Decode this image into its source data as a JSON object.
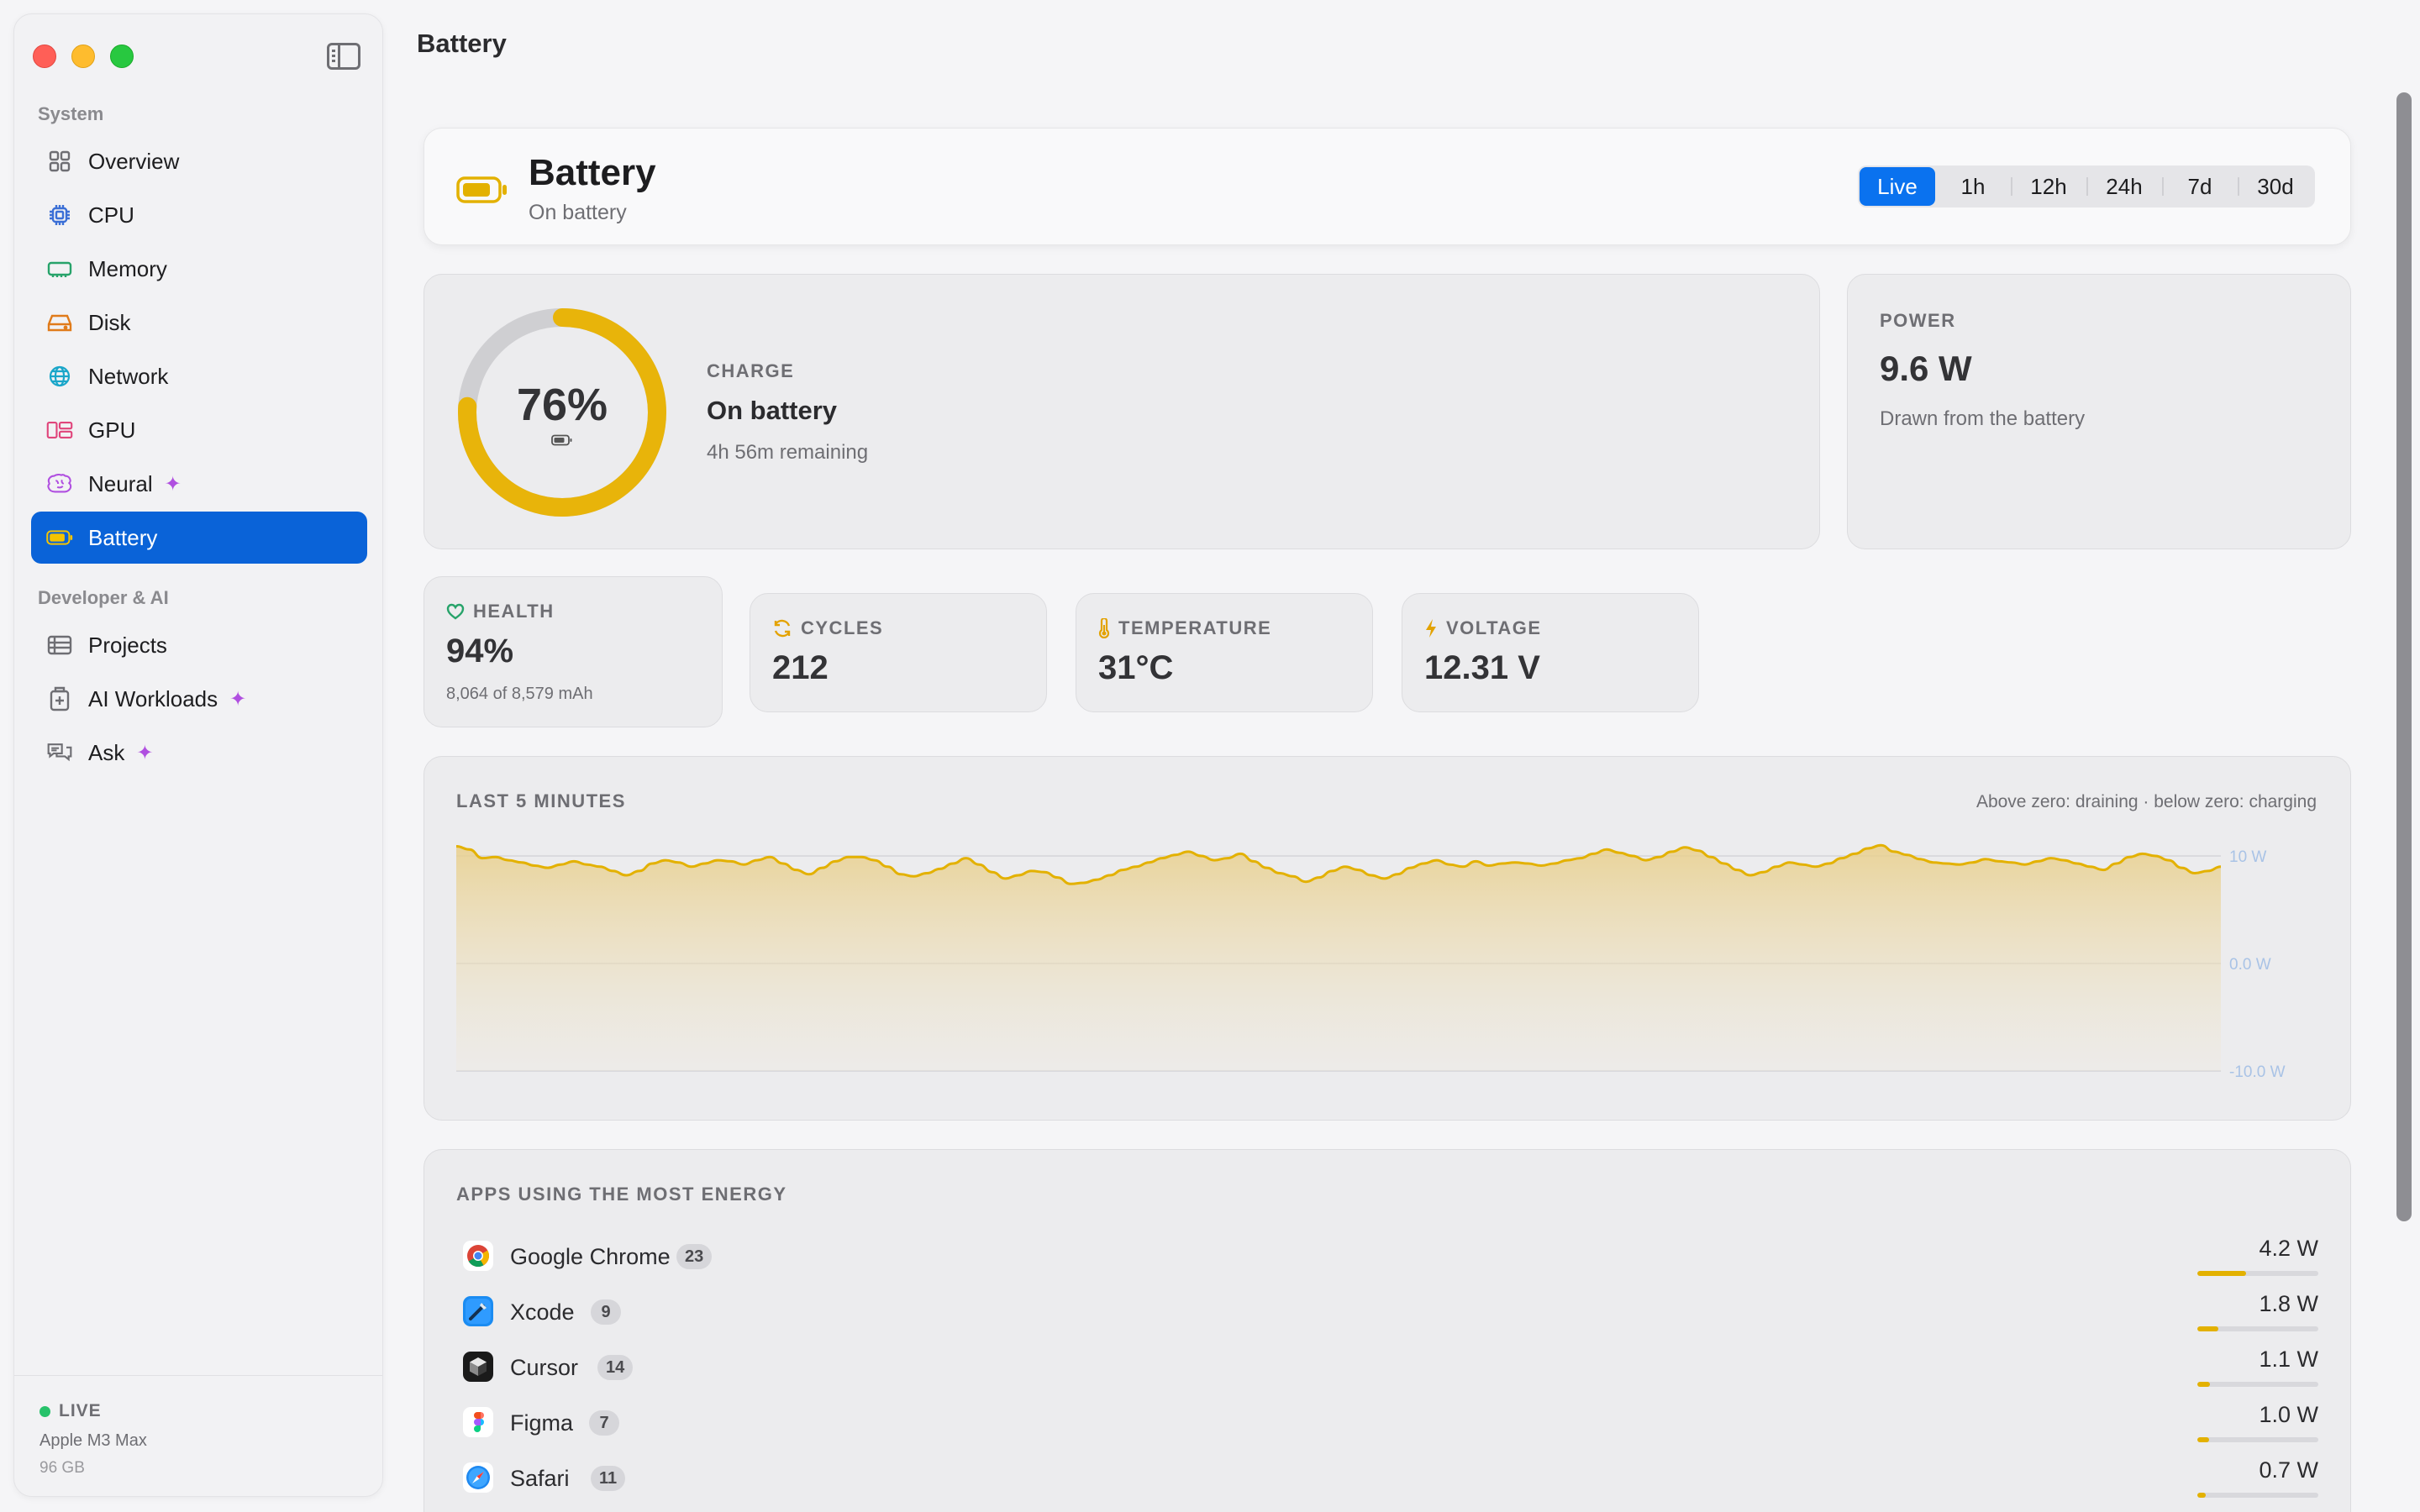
{
  "sidebar": {
    "sections": [
      {
        "label": "System",
        "items": [
          {
            "label": "Overview",
            "icon": "grid-icon",
            "color": "#6e6e73"
          },
          {
            "label": "CPU",
            "icon": "chip-icon",
            "color": "#3b6fd6"
          },
          {
            "label": "Memory",
            "icon": "memory-icon",
            "color": "#27a36a"
          },
          {
            "label": "Disk",
            "icon": "disk-icon",
            "color": "#e07b1a"
          },
          {
            "label": "Network",
            "icon": "globe-icon",
            "color": "#1aa6c9"
          },
          {
            "label": "GPU",
            "icon": "gpu-icon",
            "color": "#e0457b"
          },
          {
            "label": "Neural",
            "icon": "brain-icon",
            "color": "#b04fe0",
            "sparkle": true
          },
          {
            "label": "Battery",
            "icon": "battery-icon",
            "color": "#e3b100",
            "active": true
          }
        ]
      },
      {
        "label": "Developer & AI",
        "items": [
          {
            "label": "Projects",
            "icon": "projects-icon",
            "color": "#6e6e73"
          },
          {
            "label": "AI Workloads",
            "icon": "workloads-icon",
            "color": "#6e6e73",
            "sparkle": true
          },
          {
            "label": "Ask",
            "icon": "chat-icon",
            "color": "#6e6e73",
            "sparkle": true
          }
        ]
      }
    ],
    "footer": {
      "status": "LIVE",
      "chip": "Apple M3 Max",
      "memory": "96 GB"
    }
  },
  "page": {
    "title": "Battery"
  },
  "header": {
    "title": "Battery",
    "subtitle": "On battery",
    "ranges": [
      "Live",
      "1h",
      "12h",
      "24h",
      "7d",
      "30d"
    ],
    "active_range": "Live"
  },
  "charge": {
    "percent": 76,
    "percent_label": "76%",
    "label": "CHARGE",
    "status": "On battery",
    "remaining": "4h 56m remaining"
  },
  "power": {
    "label": "POWER",
    "value": "9.6 W",
    "sub": "Drawn from the battery"
  },
  "stats": [
    {
      "label": "HEALTH",
      "value": "94%",
      "sub": "8,064 of 8,579 mAh",
      "icon": "heart-icon",
      "color": "#27a36a"
    },
    {
      "label": "CYCLES",
      "value": "212",
      "icon": "cycle-icon",
      "color": "#e3a200"
    },
    {
      "label": "TEMPERATURE",
      "value": "31°C",
      "icon": "thermometer-icon",
      "color": "#e3a200"
    },
    {
      "label": "VOLTAGE",
      "value": "12.31 V",
      "icon": "bolt-icon",
      "color": "#e3a200"
    }
  ],
  "chart": {
    "title": "LAST 5 MINUTES",
    "note": "Above zero: draining · below zero: charging",
    "accent": "#e3b100"
  },
  "chart_data": {
    "type": "area",
    "title": "LAST 5 MINUTES",
    "ylim": [
      -10,
      10
    ],
    "yticks": [
      "10 W",
      "0.0 W",
      "-10.0 W"
    ],
    "ytick_values": [
      10,
      0,
      -10
    ],
    "values": [
      10.9,
      10.6,
      9.8,
      9.9,
      9.6,
      9.4,
      9.1,
      8.9,
      9.2,
      9.5,
      9.2,
      9.0,
      8.6,
      8.2,
      8.6,
      9.3,
      9.6,
      9.4,
      9.0,
      9.3,
      9.6,
      9.5,
      9.2,
      9.6,
      9.9,
      9.3,
      8.7,
      8.3,
      8.9,
      9.5,
      9.9,
      9.9,
      9.6,
      9.0,
      8.3,
      8.1,
      8.4,
      8.8,
      9.3,
      9.8,
      9.2,
      8.5,
      7.9,
      8.2,
      8.6,
      8.5,
      8.0,
      7.4,
      7.5,
      7.8,
      8.2,
      8.7,
      9.0,
      9.4,
      9.8,
      10.1,
      10.4,
      10.0,
      9.6,
      9.8,
      10.2,
      9.5,
      8.9,
      8.4,
      8.1,
      7.6,
      8.0,
      8.6,
      9.0,
      8.7,
      8.2,
      7.9,
      8.3,
      8.9,
      9.3,
      9.6,
      9.2,
      9.0,
      9.5,
      9.1,
      9.3,
      9.4,
      9.3,
      9.1,
      9.3,
      9.6,
      9.8,
      10.2,
      10.6,
      10.3,
      10.0,
      9.6,
      9.9,
      10.4,
      10.8,
      10.5,
      9.9,
      9.3,
      8.7,
      8.2,
      8.5,
      9.0,
      9.4,
      9.2,
      9.0,
      9.3,
      9.8,
      10.2,
      10.7,
      11.0,
      10.4,
      10.1,
      9.7,
      9.4,
      9.3,
      9.2,
      9.4,
      9.7,
      9.5,
      9.4,
      9.2,
      9.5,
      9.8,
      9.6,
      9.3,
      9.0,
      8.7,
      9.3,
      9.9,
      10.2,
      10.0,
      9.6,
      8.9,
      8.4,
      8.6,
      9.0
    ],
    "series": [
      {
        "values_ref": "values"
      }
    ]
  },
  "apps": {
    "title": "APPS USING THE MOST ENERGY",
    "items": [
      {
        "name": "Google Chrome",
        "count": "23",
        "watts": "4.2 W",
        "value": 4.2,
        "icon": "chrome-icon"
      },
      {
        "name": "Xcode",
        "count": "9",
        "watts": "1.8 W",
        "value": 1.8,
        "icon": "xcode-icon"
      },
      {
        "name": "Cursor",
        "count": "14",
        "watts": "1.1 W",
        "value": 1.1,
        "icon": "cursor-icon"
      },
      {
        "name": "Figma",
        "count": "7",
        "watts": "1.0 W",
        "value": 1.0,
        "icon": "figma-icon"
      },
      {
        "name": "Safari",
        "count": "11",
        "watts": "0.7 W",
        "value": 0.7,
        "icon": "safari-icon"
      }
    ],
    "scale_max": 10.5
  }
}
